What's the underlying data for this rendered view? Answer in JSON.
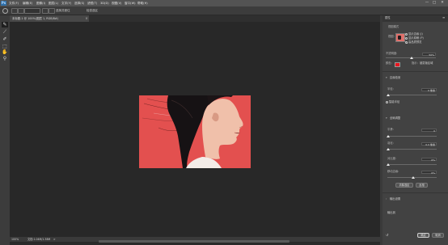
{
  "app": {
    "logo": "Ps",
    "menus": [
      "文件(F)",
      "编辑(E)",
      "图像(I)",
      "图层(L)",
      "文字(Y)",
      "选择(S)",
      "滤镜(T)",
      "3D(D)",
      "视图(V)",
      "窗口(W)",
      "帮助(H)"
    ],
    "window_controls": [
      "—",
      "□",
      "✕"
    ]
  },
  "options_bar": {
    "btn1_label": "选择并遮住",
    "btn2_label": "检查选区"
  },
  "document": {
    "tab_title": "未标题-1 @ 100%(图层 1, RGB/8#)",
    "close": "×"
  },
  "toolbar": {
    "tools": [
      "✎",
      "⟋",
      "✐",
      "⬚",
      "✋",
      "⚲"
    ]
  },
  "status_bar": {
    "zoom": "100%",
    "doc_info": "文档:1.04M/1.38M",
    "arrow": ">"
  },
  "properties": {
    "panel_title": "属性",
    "view_mode_label": "视图模式",
    "view_label": "视图:",
    "show_edge": "显示边缘 (J)",
    "show_original": "显示原稿 (P)",
    "high_quality": "高品质预览",
    "opacity_label": "不透明度:",
    "opacity_value": "50%",
    "color_label": "颜色:",
    "show_label": "指示:",
    "show_value": "被蒙版区域",
    "edge_detection": "边缘检测",
    "radius_label": "半径:",
    "radius_value": "0 像素",
    "smart_radius": "智能半径",
    "global_refine": "全局调整",
    "smooth_label": "平滑:",
    "smooth_value": "0",
    "feather_label": "羽化:",
    "feather_value": "0.0 像素",
    "contrast_label": "对比度:",
    "contrast_value": "0%",
    "shift_edge_label": "移动边缘:",
    "shift_edge_value": "0%",
    "clear_selection": "清除选区",
    "invert": "反相",
    "output_settings": "输出设置",
    "output_to": "输出到",
    "ok": "确定",
    "cancel": "取消",
    "mask_color": "#e8141e"
  }
}
